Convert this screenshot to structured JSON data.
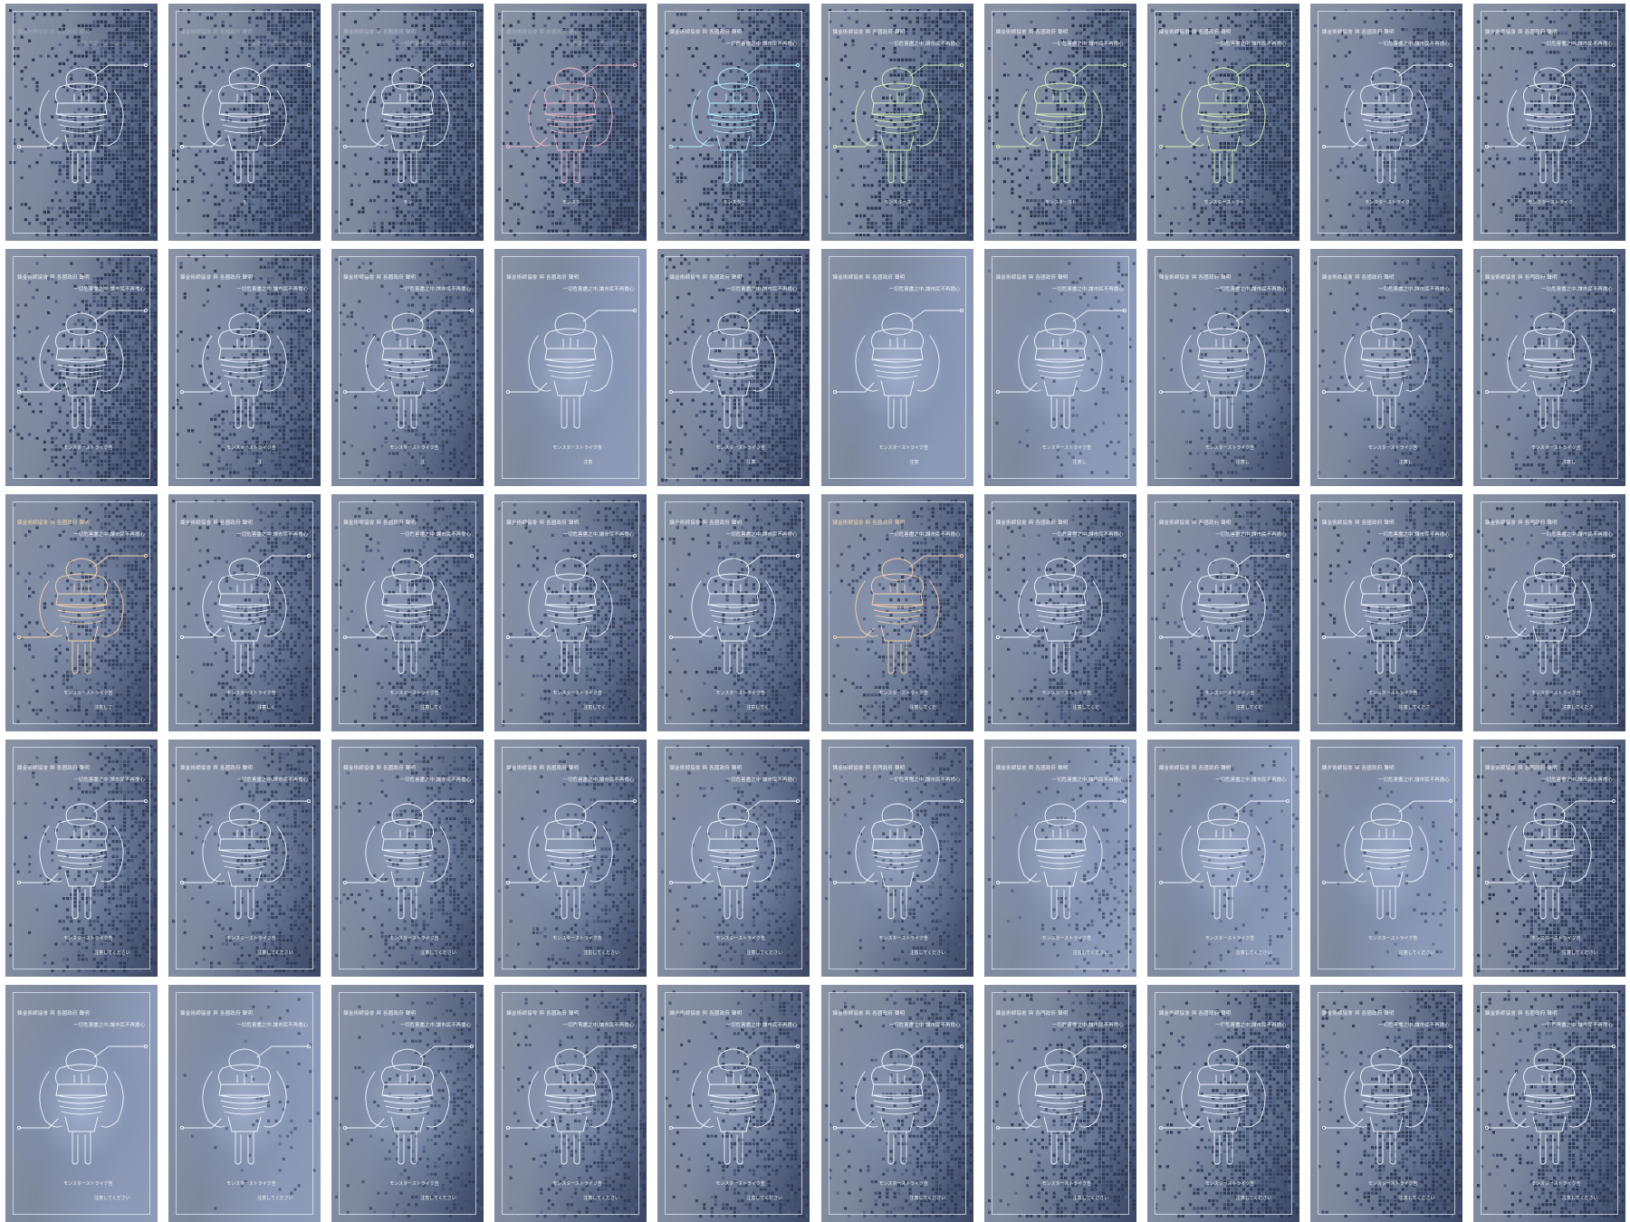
{
  "header_line_1": "鍊金術師協會 與 各國政府 聲明",
  "header_line_2": "一切危害盡之中,讓市民不再擔心",
  "caption_1_full": "モンスターストライク告",
  "caption_2_full": "注意してください",
  "colors": {
    "dark_bg": "#2b3650",
    "mid_bg": "#4f5f80",
    "light_bg": "#a8b6d3",
    "line": "#eef3ff",
    "frame_gray": "#7d8799"
  },
  "frames": [
    {
      "cap1": "",
      "cap2": "",
      "dots": 1.0,
      "glow": 0.0,
      "tint": "none",
      "h1": 0.25
    },
    {
      "cap1": "モ",
      "cap2": "",
      "dots": 1.0,
      "glow": 0.0,
      "tint": "none",
      "h1": 0.35
    },
    {
      "cap1": "モン",
      "cap2": "",
      "dots": 1.0,
      "glow": 0.0,
      "tint": "none",
      "h1": 0.45
    },
    {
      "cap1": "モンスタ",
      "cap2": "",
      "dots": 1.0,
      "glow": 0.0,
      "tint": "pink",
      "h1": 0.35
    },
    {
      "cap1": "モンスター",
      "cap2": "",
      "dots": 1.0,
      "glow": 0.0,
      "tint": "cyan",
      "h1": 1.0
    },
    {
      "cap1": "モンスタース",
      "cap2": "",
      "dots": 1.0,
      "glow": 0.0,
      "tint": "green",
      "h1": 1.0
    },
    {
      "cap1": "モンスタースト",
      "cap2": "",
      "dots": 1.0,
      "glow": 0.0,
      "tint": "green",
      "h1": 1.0
    },
    {
      "cap1": "モンスターストライ",
      "cap2": "",
      "dots": 1.0,
      "glow": 0.0,
      "tint": "green",
      "h1": 1.0
    },
    {
      "cap1": "モンスターストライク",
      "cap2": "",
      "dots": 0.7,
      "glow": 0.3,
      "tint": "none",
      "h1": 1.0
    },
    {
      "cap1": "モンスターストライク",
      "cap2": "",
      "dots": 0.85,
      "glow": 0.15,
      "tint": "none",
      "h1": 1.0
    },
    {
      "cap1": "モンスターストライク告",
      "cap2": "",
      "dots": 0.85,
      "glow": 0.2,
      "tint": "none",
      "h1": 1.0
    },
    {
      "cap1": "モンスターストライク告",
      "cap2": "注",
      "dots": 0.75,
      "glow": 0.3,
      "tint": "none",
      "h1": 1.0
    },
    {
      "cap1": "モンスターストライク告",
      "cap2": "注",
      "dots": 0.45,
      "glow": 0.5,
      "tint": "none",
      "h1": 1.0
    },
    {
      "cap1": "モンスターストライク告",
      "cap2": "注意",
      "dots": 0.0,
      "glow": 0.9,
      "tint": "none",
      "h1": 1.0
    },
    {
      "cap1": "モンスターストライク告",
      "cap2": "注意",
      "dots": 0.8,
      "glow": 0.3,
      "tint": "none",
      "h1": 1.0
    },
    {
      "cap1": "モンスターストライク告",
      "cap2": "注意",
      "dots": 0.0,
      "glow": 1.0,
      "tint": "none",
      "h1": 1.0
    },
    {
      "cap1": "モンスターストライク告",
      "cap2": "注意し",
      "dots": 0.1,
      "glow": 0.85,
      "tint": "none",
      "h1": 1.0
    },
    {
      "cap1": "モンスターストライク告",
      "cap2": "注意し",
      "dots": 0.35,
      "glow": 0.6,
      "tint": "none",
      "h1": 1.0
    },
    {
      "cap1": "モンスターストライク告",
      "cap2": "注意し",
      "dots": 0.45,
      "glow": 0.5,
      "tint": "none",
      "h1": 1.0
    },
    {
      "cap1": "モンスターストライク告",
      "cap2": "注意し",
      "dots": 0.6,
      "glow": 0.35,
      "tint": "none",
      "h1": 1.0
    },
    {
      "cap1": "モンスターストライク告",
      "cap2": "注意して",
      "dots": 0.6,
      "glow": 0.4,
      "tint": "orange",
      "h1": 1.0
    },
    {
      "cap1": "モンスターストライク告",
      "cap2": "注意しく",
      "dots": 0.6,
      "glow": 0.4,
      "tint": "none",
      "h1": 1.0
    },
    {
      "cap1": "モンスターストライク告",
      "cap2": "注意してく",
      "dots": 0.6,
      "glow": 0.4,
      "tint": "none",
      "h1": 1.0
    },
    {
      "cap1": "モンスターストライク告",
      "cap2": "注意してく",
      "dots": 0.6,
      "glow": 0.4,
      "tint": "none",
      "h1": 1.0
    },
    {
      "cap1": "モンスターストライク告",
      "cap2": "注意してく",
      "dots": 0.6,
      "glow": 0.4,
      "tint": "none",
      "h1": 1.0
    },
    {
      "cap1": "モンスターストライク告",
      "cap2": "注意してくだ",
      "dots": 0.6,
      "glow": 0.4,
      "tint": "orange",
      "h1": 1.0
    },
    {
      "cap1": "モンスターストライク告",
      "cap2": "注意してくだ",
      "dots": 0.6,
      "glow": 0.4,
      "tint": "none",
      "h1": 1.0
    },
    {
      "cap1": "モンスターストライク告",
      "cap2": "注意してくだ",
      "dots": 0.6,
      "glow": 0.4,
      "tint": "none",
      "h1": 1.0
    },
    {
      "cap1": "モンスターストライク告",
      "cap2": "注意してくださ",
      "dots": 0.65,
      "glow": 0.35,
      "tint": "none",
      "h1": 1.0
    },
    {
      "cap1": "モンスターストライク告",
      "cap2": "注意してくださ",
      "dots": 0.7,
      "glow": 0.3,
      "tint": "none",
      "h1": 1.0
    },
    {
      "cap1": "モンスターストライク告",
      "cap2": "注意してください",
      "dots": 0.55,
      "glow": 0.45,
      "tint": "none",
      "h1": 1.0
    },
    {
      "cap1": "モンスターストライク告",
      "cap2": "注意してください",
      "dots": 0.5,
      "glow": 0.5,
      "tint": "none",
      "h1": 1.0
    },
    {
      "cap1": "モンスターストライク告",
      "cap2": "注意してください",
      "dots": 0.45,
      "glow": 0.55,
      "tint": "none",
      "h1": 1.0
    },
    {
      "cap1": "モンスターストライク告",
      "cap2": "注意してください",
      "dots": 0.4,
      "glow": 0.6,
      "tint": "none",
      "h1": 1.0
    },
    {
      "cap1": "モンスターストライク告",
      "cap2": "注意してください",
      "dots": 0.35,
      "glow": 0.65,
      "tint": "none",
      "h1": 1.0
    },
    {
      "cap1": "モンスターストライク告",
      "cap2": "注意してください",
      "dots": 0.3,
      "glow": 0.7,
      "tint": "none",
      "h1": 1.0
    },
    {
      "cap1": "モンスターストライク告",
      "cap2": "注意してください",
      "dots": 0.2,
      "glow": 0.8,
      "tint": "none",
      "h1": 1.0
    },
    {
      "cap1": "モンスターストライク告",
      "cap2": "注意してください",
      "dots": 0.1,
      "glow": 0.9,
      "tint": "none",
      "h1": 1.0
    },
    {
      "cap1": "モンスターストライク告",
      "cap2": "注意してください",
      "dots": 0.05,
      "glow": 1.0,
      "tint": "none",
      "h1": 1.0
    },
    {
      "cap1": "モンスターストライク告",
      "cap2": "注意してください",
      "dots": 0.9,
      "glow": 0.2,
      "tint": "none",
      "h1": 1.0
    },
    {
      "cap1": "モンスターストライク告",
      "cap2": "注意してください",
      "dots": 0.0,
      "glow": 1.0,
      "tint": "none",
      "h1": 1.0
    },
    {
      "cap1": "モンスターストライク告",
      "cap2": "注意してください",
      "dots": 0.05,
      "glow": 0.9,
      "tint": "none",
      "h1": 1.0
    },
    {
      "cap1": "モンスターストライク告",
      "cap2": "注意してください",
      "dots": 0.3,
      "glow": 0.7,
      "tint": "none",
      "h1": 1.0
    },
    {
      "cap1": "モンスターストライク告",
      "cap2": "注意してください",
      "dots": 0.45,
      "glow": 0.55,
      "tint": "none",
      "h1": 1.0
    },
    {
      "cap1": "モンスターストライク告",
      "cap2": "注意してください",
      "dots": 0.55,
      "glow": 0.45,
      "tint": "none",
      "h1": 1.0
    },
    {
      "cap1": "モンスターストライク告",
      "cap2": "注意してください",
      "dots": 0.6,
      "glow": 0.4,
      "tint": "none",
      "h1": 1.0
    },
    {
      "cap1": "モンスターストライク告",
      "cap2": "注意してください",
      "dots": 0.7,
      "glow": 0.35,
      "tint": "none",
      "h1": 1.0
    },
    {
      "cap1": "モンスターストライク告",
      "cap2": "注意してください",
      "dots": 0.75,
      "glow": 0.3,
      "tint": "none",
      "h1": 1.0
    },
    {
      "cap1": "モンスターストライク告",
      "cap2": "注意してください",
      "dots": 0.8,
      "glow": 0.25,
      "tint": "none",
      "h1": 1.0
    },
    {
      "cap1": "モンスターストライク告",
      "cap2": "注意してください",
      "dots": 0.85,
      "glow": 0.2,
      "tint": "none",
      "h1": 1.0
    }
  ]
}
